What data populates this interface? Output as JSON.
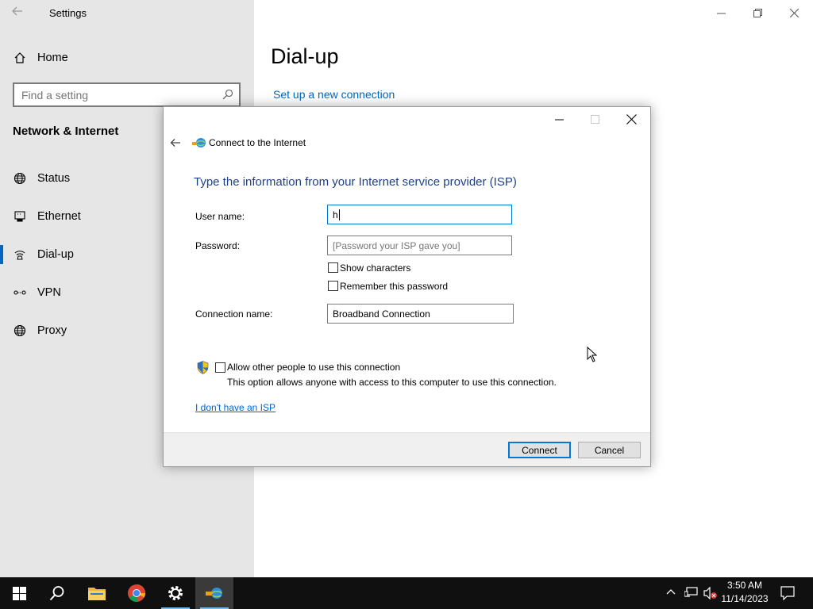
{
  "settings": {
    "title": "Settings",
    "home_label": "Home",
    "search_placeholder": "Find a setting",
    "section_title": "Network & Internet",
    "nav_items": [
      {
        "label": "Status",
        "icon": "globe-icon"
      },
      {
        "label": "Ethernet",
        "icon": "ethernet-icon"
      },
      {
        "label": "Dial-up",
        "icon": "dialup-icon",
        "active": true
      },
      {
        "label": "VPN",
        "icon": "vpn-icon"
      },
      {
        "label": "Proxy",
        "icon": "globe-icon"
      }
    ],
    "page_title": "Dial-up",
    "setup_link": "Set up a new connection",
    "accent_color": "#0067c0"
  },
  "dialog": {
    "title": "Connect to the Internet",
    "heading": "Type the information from your Internet service provider (ISP)",
    "username_label": "User name:",
    "username_value": "h",
    "password_label": "Password:",
    "password_placeholder": "[Password your ISP gave you]",
    "show_characters_label": "Show characters",
    "remember_password_label": "Remember this password",
    "connection_name_label": "Connection name:",
    "connection_name_value": "Broadband Connection",
    "allow_others_label": "Allow other people to use this connection",
    "allow_others_desc": "This option allows anyone with access to this computer to use this connection.",
    "no_isp_link": "I don't have an ISP",
    "connect_button": "Connect",
    "cancel_button": "Cancel",
    "heading_color": "#1e3f8a"
  },
  "taskbar": {
    "time": "3:50 AM",
    "date": "11/14/2023",
    "apps": [
      "windows-start-icon",
      "search-icon",
      "file-explorer-icon",
      "chrome-icon",
      "settings-gear-icon",
      "network-connection-icon"
    ]
  }
}
